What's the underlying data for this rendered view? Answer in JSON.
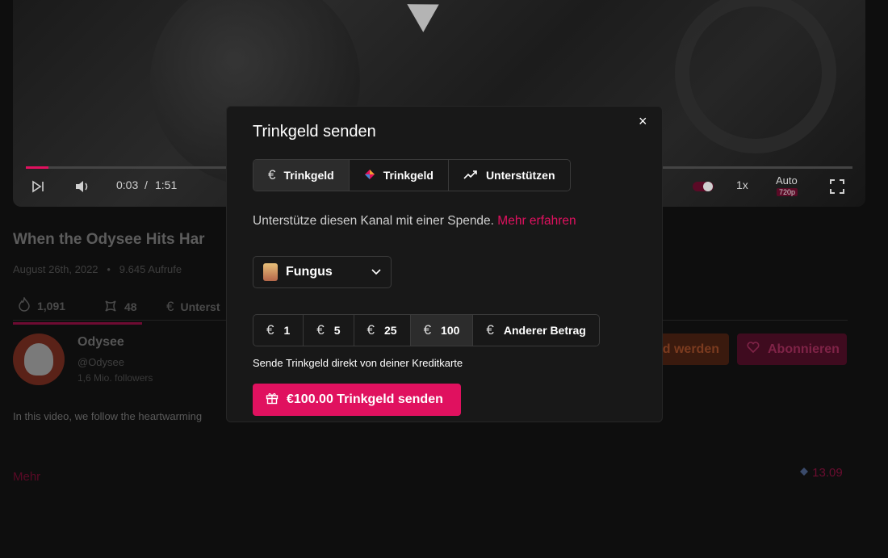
{
  "video": {
    "current_time": "0:03",
    "separator": "/",
    "duration": "1:51",
    "progress_fraction": 0.027,
    "speed": "1x",
    "quality_mode": "Auto",
    "quality_badge": "720p"
  },
  "page": {
    "title": "When the Odysee Hits Har",
    "date": "August 26th, 2022",
    "views": "9.645 Aufrufe",
    "dot": "•",
    "actions": [
      {
        "icon": "fire-icon",
        "count": "1,091"
      },
      {
        "icon": "slime-icon",
        "count": "48"
      },
      {
        "icon": "euro-icon",
        "label": "Unterst"
      }
    ],
    "channel": {
      "name": "Odysee",
      "handle": "@Odysee",
      "followers": "1,6 Mio. followers"
    },
    "description": "In this video, we follow the heartwarming",
    "more_link": "Mehr",
    "member_button": "d werden",
    "subscribe_button": "Abonnieren",
    "credits": "13.09"
  },
  "modal": {
    "title": "Trinkgeld senden",
    "close_label": "×",
    "tabs": [
      {
        "icon": "euro-icon",
        "label": "Trinkgeld",
        "active": true
      },
      {
        "icon": "lbc-icon",
        "label": "Trinkgeld",
        "active": false
      },
      {
        "icon": "trending-up-icon",
        "label": "Unterstützen",
        "active": false
      }
    ],
    "support_text": "Unterstütze diesen Kanal mit einer Spende.",
    "support_link": "Mehr erfahren",
    "selected_channel": "Fungus",
    "currency_symbol": "€",
    "amounts": [
      {
        "value": "1",
        "active": false
      },
      {
        "value": "5",
        "active": false
      },
      {
        "value": "25",
        "active": false
      },
      {
        "value": "100",
        "active": true
      },
      {
        "value": "Anderer Betrag",
        "active": false
      }
    ],
    "card_note": "Sende Trinkgeld direkt von deiner Kreditkarte",
    "send_button": "€100.00 Trinkgeld senden"
  },
  "colors": {
    "accent": "#e0115f",
    "modal_bg": "#181818",
    "page_bg": "#0e0e0e"
  }
}
